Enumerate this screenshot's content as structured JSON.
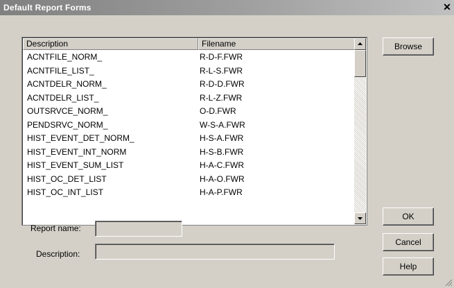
{
  "window": {
    "title": "Default Report Forms",
    "close_glyph": "✕"
  },
  "list": {
    "columns": [
      "Description",
      "Filename"
    ],
    "rows": [
      {
        "description": "ACNTFILE_NORM_",
        "filename": "R-D-F.FWR"
      },
      {
        "description": "ACNTFILE_LIST_",
        "filename": "R-L-S.FWR"
      },
      {
        "description": "ACNTDELR_NORM_",
        "filename": "R-D-D.FWR"
      },
      {
        "description": "ACNTDELR_LIST_",
        "filename": "R-L-Z.FWR"
      },
      {
        "description": "OUTSRVCE_NORM_",
        "filename": "O-D.FWR"
      },
      {
        "description": "PENDSRVC_NORM_",
        "filename": "W-S-A.FWR"
      },
      {
        "description": "HIST_EVENT_DET_NORM_",
        "filename": "H-S-A.FWR"
      },
      {
        "description": "HIST_EVENT_INT_NORM",
        "filename": "H-S-B.FWR"
      },
      {
        "description": "HIST_EVENT_SUM_LIST",
        "filename": "H-A-C.FWR"
      },
      {
        "description": "HIST_OC_DET_LIST",
        "filename": "H-A-O.FWR"
      },
      {
        "description": "HIST_OC_INT_LIST",
        "filename": "H-A-P.FWR"
      }
    ]
  },
  "buttons": {
    "browse": "Browse",
    "ok": "OK",
    "cancel": "Cancel",
    "help": "Help"
  },
  "form": {
    "report_name_label": "Report name:",
    "report_name_value": "",
    "description_label": "Description:",
    "description_value": ""
  }
}
